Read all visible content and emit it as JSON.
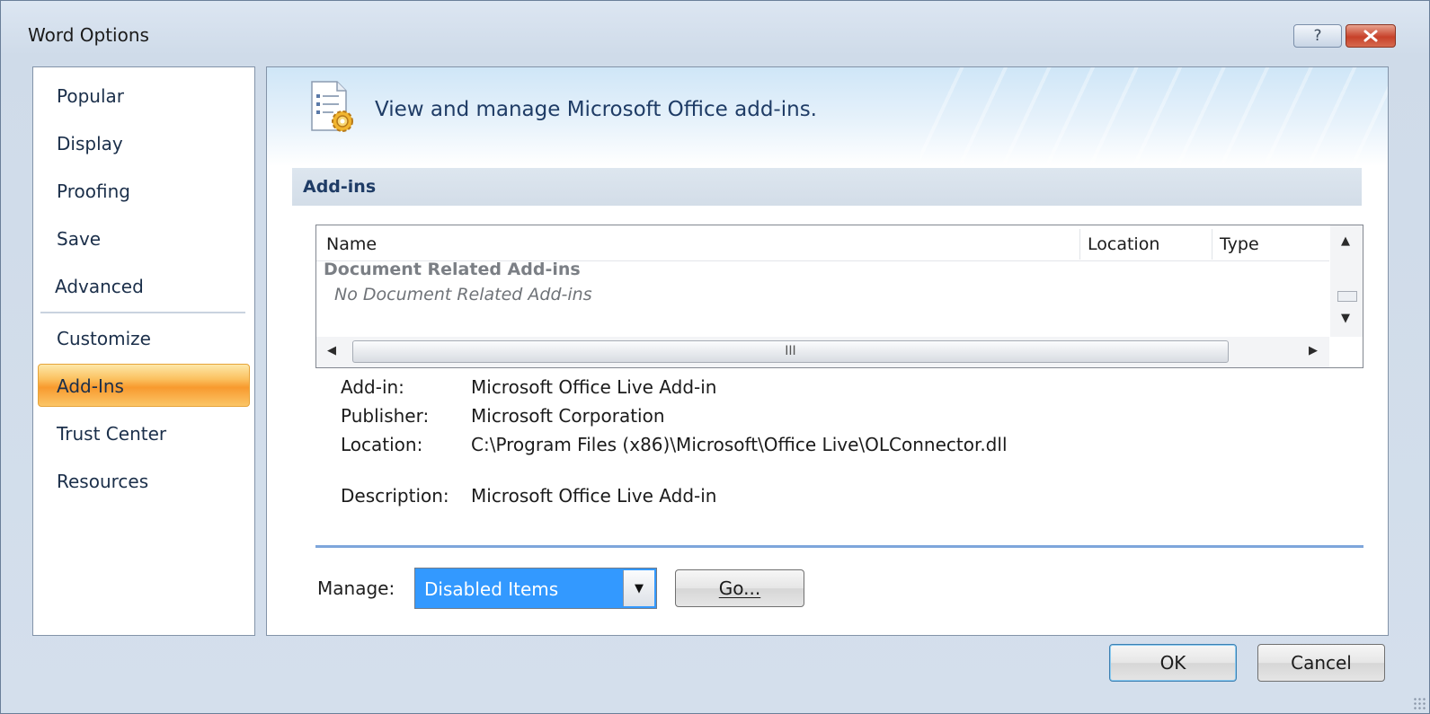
{
  "window": {
    "title": "Word Options",
    "help_label": "?",
    "close_label": "✕"
  },
  "sidebar": {
    "items": [
      {
        "label": "Popular"
      },
      {
        "label": "Display"
      },
      {
        "label": "Proofing"
      },
      {
        "label": "Save"
      },
      {
        "label": "Advanced"
      },
      {
        "label": "Customize"
      },
      {
        "label": "Add-Ins"
      },
      {
        "label": "Trust Center"
      },
      {
        "label": "Resources"
      }
    ],
    "selected": "Add-Ins"
  },
  "banner": {
    "text": "View and manage Microsoft Office add-ins.",
    "icon": "addins-gear-icon"
  },
  "section": {
    "title": "Add-ins"
  },
  "addins_list": {
    "columns": [
      "Name",
      "Location",
      "Type"
    ],
    "group_label": "Document Related Add-ins",
    "empty_text": "No Document Related Add-ins",
    "hscroll_grip": "III"
  },
  "details": {
    "addin_label": "Add-in:",
    "addin_value": "Microsoft Office Live Add-in",
    "publisher_label": "Publisher:",
    "publisher_value": "Microsoft Corporation",
    "location_label": "Location:",
    "location_value": "C:\\Program Files (x86)\\Microsoft\\Office Live\\OLConnector.dll",
    "description_label": "Description:",
    "description_value": "Microsoft Office Live Add-in"
  },
  "manage": {
    "label": "Manage:",
    "selected": "Disabled Items",
    "go_label": "Go..."
  },
  "footer": {
    "ok_label": "OK",
    "cancel_label": "Cancel"
  },
  "colors": {
    "accent": "#3399ff",
    "selected_nav": "#f89a2e",
    "header_text": "#1f3c66"
  }
}
